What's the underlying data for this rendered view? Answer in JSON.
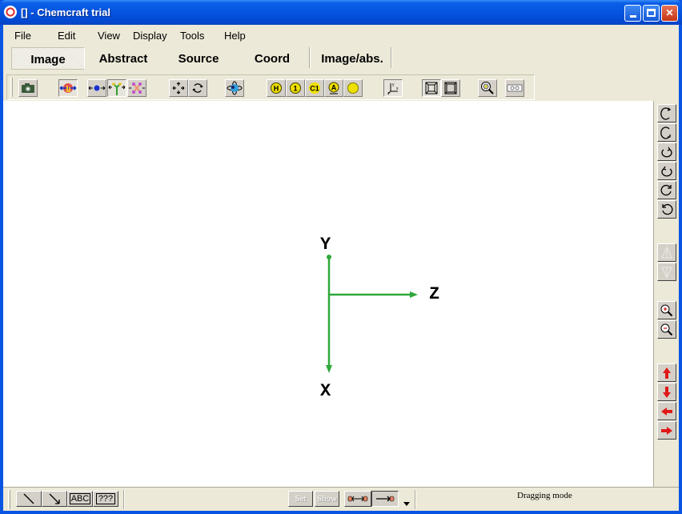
{
  "window": {
    "title": "[] - Chemcraft trial",
    "controls": {
      "minimize": "_",
      "maximize": "□",
      "close": "✕"
    }
  },
  "menubar": {
    "items": [
      "File",
      "Edit",
      "View",
      "Display",
      "Tools",
      "Help"
    ]
  },
  "tabs": {
    "items": [
      "Image",
      "Abstract",
      "Source",
      "Coord",
      "Image/abs."
    ],
    "active": "Image"
  },
  "toolbar": {
    "buttons": [
      {
        "name": "camera-icon",
        "pressed": false
      },
      {
        "name": "drag-rotate-hand-icon",
        "pressed": true
      },
      {
        "name": "move-atom-icon",
        "pressed": false
      },
      {
        "name": "move-fragment-icon",
        "pressed": true
      },
      {
        "name": "move-group-icon",
        "pressed": false
      },
      {
        "name": "fit-to-screen-icon",
        "pressed": false
      },
      {
        "name": "rotate-reset-icon",
        "pressed": false
      },
      {
        "name": "orbital-view-icon",
        "pressed": false
      },
      {
        "name": "label-element-icon",
        "text": "H"
      },
      {
        "name": "label-number-icon",
        "text": "1"
      },
      {
        "name": "label-element-number-icon",
        "text": "C1"
      },
      {
        "name": "label-symbol-icon",
        "text": "A"
      },
      {
        "name": "label-none-icon",
        "text": ""
      },
      {
        "name": "show-axes-icon",
        "pressed": true
      },
      {
        "name": "perspective-box-icon",
        "pressed": true
      },
      {
        "name": "orthogonal-box-icon",
        "pressed": false
      },
      {
        "name": "zoom-lens-icon",
        "pressed": false
      },
      {
        "name": "stereo-view-icon",
        "pressed": false
      }
    ]
  },
  "canvas": {
    "axes": {
      "x": "X",
      "y": "Y",
      "z": "Z"
    },
    "axis_color": "#2ea83a"
  },
  "rightbar": {
    "buttons": [
      {
        "name": "rotate-x-cw-icon",
        "disabled": false
      },
      {
        "name": "rotate-x-ccw-icon",
        "disabled": false
      },
      {
        "name": "rotate-y-cw-icon",
        "disabled": false
      },
      {
        "name": "rotate-y-ccw-icon",
        "disabled": false
      },
      {
        "name": "rotate-z-cw-icon",
        "disabled": false
      },
      {
        "name": "rotate-z-ccw-icon",
        "disabled": false
      },
      {
        "name": "perspective-up-icon",
        "disabled": true
      },
      {
        "name": "perspective-down-icon",
        "disabled": true
      },
      {
        "name": "zoom-in-icon",
        "disabled": false
      },
      {
        "name": "zoom-out-icon",
        "disabled": false
      },
      {
        "name": "move-up-icon",
        "disabled": false
      },
      {
        "name": "move-down-icon",
        "disabled": false
      },
      {
        "name": "move-left-icon",
        "disabled": false
      },
      {
        "name": "move-right-icon",
        "disabled": false
      }
    ]
  },
  "bottombar": {
    "draw_line": "line",
    "draw_arrow": "arrow",
    "text_abc": "ABC",
    "text_unknown": "???",
    "set_label": "Set",
    "show_label": "Show",
    "status": "Dragging mode"
  }
}
